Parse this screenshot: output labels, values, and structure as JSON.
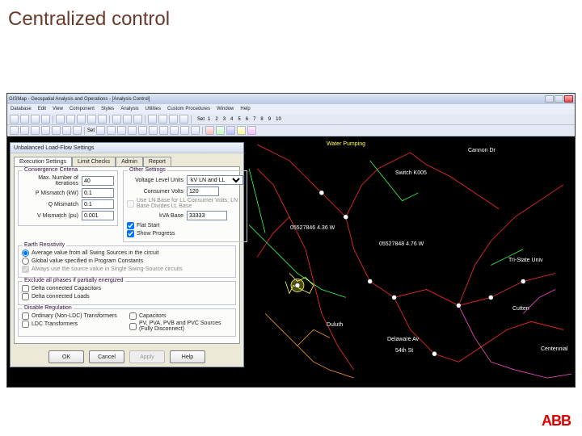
{
  "slide": {
    "title": "Centralized control",
    "logo": "ABB"
  },
  "app": {
    "title": "GISMap - Geospatial Analysis and Operations - [Analysis Control]",
    "menus": [
      "Database",
      "Edit",
      "View",
      "Component",
      "Styles",
      "Analysis",
      "Utilities",
      "Custom Procedures",
      "Window",
      "Help"
    ],
    "toolbar_sets_label": "Set",
    "toolbar_sets": [
      "1",
      "2",
      "3",
      "4",
      "5",
      "6",
      "7",
      "8",
      "9",
      "10"
    ],
    "toolbar_cset": "1"
  },
  "dialog": {
    "title": "Unbalanced Load-Flow Settings",
    "tabs": [
      "Execution Settings",
      "Limit Checks",
      "Admin",
      "Report"
    ],
    "active_tab": "Execution Settings",
    "groups": {
      "convergence": {
        "label": "Convergence Criteria",
        "max_iter_label": "Max. Number of Iterations",
        "max_iter": "40",
        "p_mismatch_label": "P Mismatch (kW)",
        "p_mismatch": "0.1",
        "q_mismatch_label": "Q Mismatch",
        "q_mismatch": "0.1",
        "v_mismatch_label": "V Mismatch (pu)",
        "v_mismatch": "0.001"
      },
      "other": {
        "label": "Other Settings",
        "voltage_level_label": "Voltage Level Units",
        "voltage_level_units": "kV LN and LL",
        "consumer_volts_label": "Consumer Volts",
        "consumer_volts": "120",
        "use_ln_label": "Use LN Base for LL Consumer Volts; LN Base Divides LL Base",
        "kva_base_label": "kVA Base",
        "kva_base": "33333",
        "flat_start_label": "Flat Start",
        "show_progress_label": "Show Progress"
      },
      "earth": {
        "label": "Earth Resistivity",
        "avg_label": "Average value from all Swing Sources in the circuit",
        "global_label": "Global value specified in Program Constants",
        "always_label": "Always use the source value in Single Swing-Source circuits"
      },
      "exclude": {
        "label": "Exclude all phases if partially energized",
        "delta_cap_label": "Delta connected Capacitors",
        "delta_load_label": "Delta connected Loads"
      },
      "disable": {
        "label": "Disable Regulation",
        "ordinary_label": "Ordinary (Non-LDC) Transformers",
        "ldc_label": "LDC Transformers",
        "capacitors_label": "Capacitors",
        "pv_label": "PV, PVA, PVB and PVC Sources (Fully Disconnect)"
      }
    },
    "buttons": {
      "ok": "OK",
      "cancel": "Cancel",
      "apply": "Apply",
      "help": "Help"
    }
  },
  "map_labels": {
    "water_pumping": "Water Pumping",
    "cannon": "Cannon Dr",
    "switch": "Switch K005",
    "tooltip1": "05527846 4.36 W",
    "tooltip2": "05527848 4.76 W",
    "tristate": "Tri-State Univ",
    "duluth": "Duluth",
    "delaware": "Delaware Av",
    "fiftyfourth": "54th St",
    "cutten": "Cutten",
    "centennial": "Centennial"
  },
  "colors": {
    "red": "#ff2a2a",
    "green": "#36ff4f",
    "magenta": "#ff4fd0",
    "orange": "#ff9a2a",
    "yellow": "#ffff55"
  }
}
